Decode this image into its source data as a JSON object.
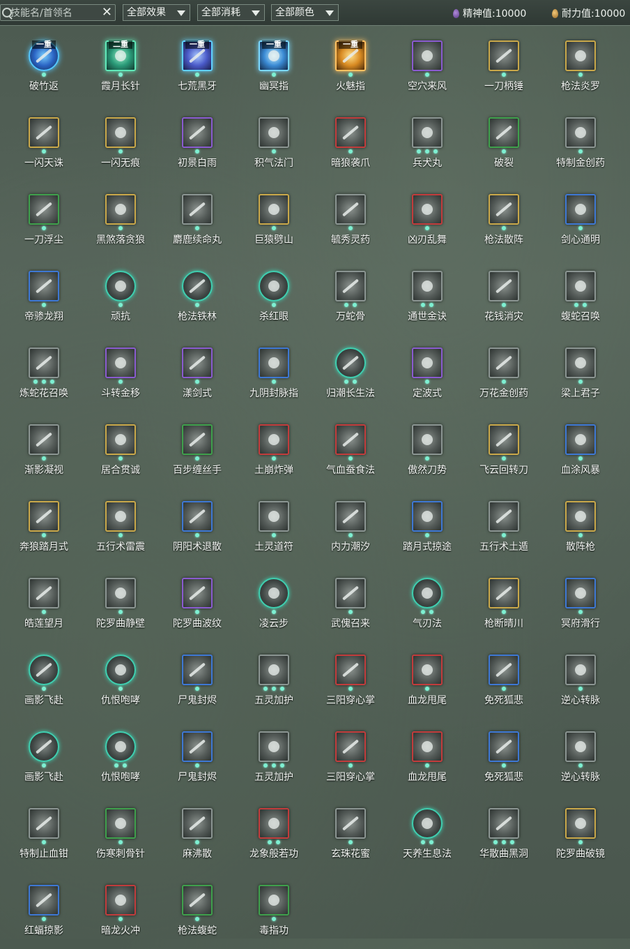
{
  "toolbar": {
    "search_placeholder": "技能名/首领名",
    "clear_glyph": "✕",
    "filters": [
      {
        "label": "全部效果"
      },
      {
        "label": "全部消耗"
      },
      {
        "label": "全部颜色"
      }
    ],
    "spirit": {
      "label": "精神值:",
      "value": "10000",
      "icon": "spirit-drop-icon",
      "color": "#8a5bd0"
    },
    "stamina": {
      "label": "耐力值:",
      "value": "10000",
      "icon": "stamina-drop-icon",
      "color": "#d49a3c"
    }
  },
  "skills": [
    {
      "name": "破竹返",
      "frame": "c-blue",
      "dots": 1,
      "badge": "一重"
    },
    {
      "name": "霞月长针",
      "frame": "c-teal",
      "dots": 1,
      "badge": "二重"
    },
    {
      "name": "七荒黑牙",
      "frame": "c-violet",
      "dots": 1,
      "badge": "一重"
    },
    {
      "name": "幽冥指",
      "frame": "c-cyan",
      "dots": 1,
      "badge": "一重"
    },
    {
      "name": "火魅指",
      "frame": "c-fire",
      "dots": 1,
      "badge": "一重"
    },
    {
      "name": "空穴来风",
      "frame": "purple",
      "dots": 1
    },
    {
      "name": "一刀柄锤",
      "frame": "gold",
      "dots": 1
    },
    {
      "name": "枪法炎罗",
      "frame": "gold",
      "dots": 1
    },
    {
      "name": "一闪天诛",
      "frame": "gold",
      "dots": 1
    },
    {
      "name": "一闪无痕",
      "frame": "gold",
      "dots": 1
    },
    {
      "name": "初景白雨",
      "frame": "purple",
      "dots": 1
    },
    {
      "name": "积气法门",
      "frame": "gray",
      "dots": 1
    },
    {
      "name": "暗狼袭爪",
      "frame": "red",
      "dots": 1
    },
    {
      "name": "兵犬丸",
      "frame": "gray",
      "dots": 3
    },
    {
      "name": "破裂",
      "frame": "green",
      "dots": 1
    },
    {
      "name": "特制金创药",
      "frame": "gray",
      "dots": 1
    },
    {
      "name": "一刀浮尘",
      "frame": "green",
      "dots": 1
    },
    {
      "name": "黑煞落贪狼",
      "frame": "gold",
      "dots": 1
    },
    {
      "name": "麝鹿续命丸",
      "frame": "gray",
      "dots": 1
    },
    {
      "name": "巨猿劈山",
      "frame": "gold",
      "dots": 1
    },
    {
      "name": "毓秀灵药",
      "frame": "gray",
      "dots": 1
    },
    {
      "name": "凶刃乱舞",
      "frame": "red",
      "dots": 1
    },
    {
      "name": "枪法散阵",
      "frame": "gold",
      "dots": 1
    },
    {
      "name": "剑心通明",
      "frame": "blue",
      "dots": 1
    },
    {
      "name": "帝骖龙翔",
      "frame": "blue",
      "dots": 1
    },
    {
      "name": "顽抗",
      "frame": "round",
      "dots": 1
    },
    {
      "name": "枪法铁林",
      "frame": "round",
      "dots": 1
    },
    {
      "name": "杀红眼",
      "frame": "round",
      "dots": 1
    },
    {
      "name": "万蛇骨",
      "frame": "gray",
      "dots": 2
    },
    {
      "name": "通世金诀",
      "frame": "gray",
      "dots": 2
    },
    {
      "name": "花钱消灾",
      "frame": "gray",
      "dots": 1
    },
    {
      "name": "蝮蛇召唤",
      "frame": "gray",
      "dots": 2
    },
    {
      "name": "炼蛇花召唤",
      "frame": "gray",
      "dots": 3
    },
    {
      "name": "斗转金移",
      "frame": "purple",
      "dots": 1
    },
    {
      "name": "漾剑式",
      "frame": "purple",
      "dots": 1
    },
    {
      "name": "九阴封脉指",
      "frame": "blue",
      "dots": 1
    },
    {
      "name": "归潮长生法",
      "frame": "round",
      "dots": 2
    },
    {
      "name": "定波式",
      "frame": "purple",
      "dots": 1
    },
    {
      "name": "万花金创药",
      "frame": "gray",
      "dots": 1
    },
    {
      "name": "梁上君子",
      "frame": "gray",
      "dots": 1
    },
    {
      "name": "渐影凝视",
      "frame": "gray",
      "dots": 1
    },
    {
      "name": "居合贯诚",
      "frame": "gold",
      "dots": 1
    },
    {
      "name": "百步缠丝手",
      "frame": "green",
      "dots": 1
    },
    {
      "name": "土崩炸弹",
      "frame": "red",
      "dots": 1
    },
    {
      "name": "气血蚕食法",
      "frame": "red",
      "dots": 1
    },
    {
      "name": "傲然刀势",
      "frame": "gray",
      "dots": 1
    },
    {
      "name": "飞云回转刀",
      "frame": "gold",
      "dots": 1
    },
    {
      "name": "血涂风暴",
      "frame": "blue",
      "dots": 1
    },
    {
      "name": "奔狼踏月式",
      "frame": "gold",
      "dots": 1
    },
    {
      "name": "五行术雷震",
      "frame": "gold",
      "dots": 1
    },
    {
      "name": "阴阳术退散",
      "frame": "blue",
      "dots": 1
    },
    {
      "name": "土灵道符",
      "frame": "gray",
      "dots": 1
    },
    {
      "name": "内力潮汐",
      "frame": "gray",
      "dots": 1
    },
    {
      "name": "踏月式掠途",
      "frame": "blue",
      "dots": 1
    },
    {
      "name": "五行术土遁",
      "frame": "gray",
      "dots": 1
    },
    {
      "name": "散阵枪",
      "frame": "gold",
      "dots": 1
    },
    {
      "name": "皓莲望月",
      "frame": "gray",
      "dots": 1
    },
    {
      "name": "陀罗曲静壁",
      "frame": "gray",
      "dots": 1
    },
    {
      "name": "陀罗曲波纹",
      "frame": "purple",
      "dots": 1
    },
    {
      "name": "凌云步",
      "frame": "round",
      "dots": 1
    },
    {
      "name": "武傀召来",
      "frame": "gray",
      "dots": 1
    },
    {
      "name": "气刃法",
      "frame": "round",
      "dots": 2
    },
    {
      "name": "枪断晴川",
      "frame": "gold",
      "dots": 1
    },
    {
      "name": "冥府滑行",
      "frame": "blue",
      "dots": 1
    },
    {
      "name": "画影飞赴",
      "frame": "round",
      "dots": 1
    },
    {
      "name": "仇恨咆哮",
      "frame": "round",
      "dots": 1
    },
    {
      "name": "尸鬼封烬",
      "frame": "blue",
      "dots": 1
    },
    {
      "name": "五灵加护",
      "frame": "gray",
      "dots": 3
    },
    {
      "name": "三阳穿心掌",
      "frame": "red",
      "dots": 1
    },
    {
      "name": "血龙甩尾",
      "frame": "red",
      "dots": 1
    },
    {
      "name": "免死狐悲",
      "frame": "blue",
      "dots": 1
    },
    {
      "name": "逆心转脉",
      "frame": "gray",
      "dots": 1
    },
    {
      "name": "画影飞赴",
      "frame": "round",
      "dots": 1
    },
    {
      "name": "仇恨咆哮",
      "frame": "round",
      "dots": 2
    },
    {
      "name": "尸鬼封烬",
      "frame": "blue",
      "dots": 1
    },
    {
      "name": "五灵加护",
      "frame": "gray",
      "dots": 3
    },
    {
      "name": "三阳穿心掌",
      "frame": "red",
      "dots": 1
    },
    {
      "name": "血龙甩尾",
      "frame": "red",
      "dots": 1
    },
    {
      "name": "免死狐悲",
      "frame": "blue",
      "dots": 1
    },
    {
      "name": "逆心转脉",
      "frame": "gray",
      "dots": 1
    },
    {
      "name": "特制止血钳",
      "frame": "gray",
      "dots": 1
    },
    {
      "name": "伤寒刺骨针",
      "frame": "green",
      "dots": 1
    },
    {
      "name": "麻沸散",
      "frame": "gray",
      "dots": 1
    },
    {
      "name": "龙象般若功",
      "frame": "red",
      "dots": 2
    },
    {
      "name": "玄珠花蜜",
      "frame": "gray",
      "dots": 1
    },
    {
      "name": "天养生息法",
      "frame": "round",
      "dots": 2
    },
    {
      "name": "华散曲黑洞",
      "frame": "gray",
      "dots": 3
    },
    {
      "name": "陀罗曲破镜",
      "frame": "gold",
      "dots": 1
    },
    {
      "name": "红蝠掠影",
      "frame": "blue",
      "dots": 1
    },
    {
      "name": "暗龙火冲",
      "frame": "red",
      "dots": 1
    },
    {
      "name": "枪法蝮蛇",
      "frame": "green",
      "dots": 1
    },
    {
      "name": "毒指功",
      "frame": "green",
      "dots": 1
    }
  ]
}
